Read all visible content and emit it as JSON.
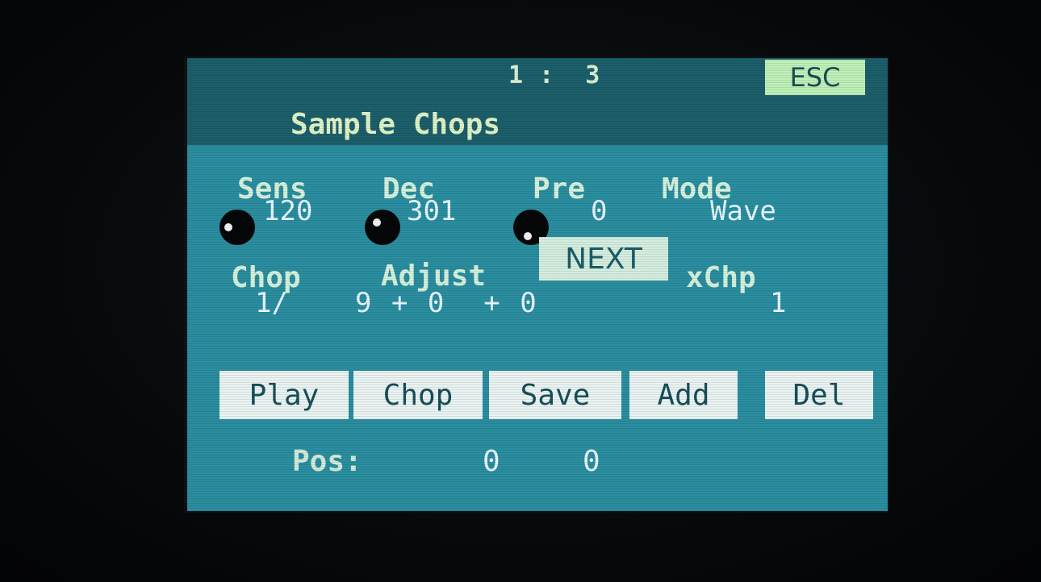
{
  "header": {
    "page_indicator": "1 :  3",
    "title": "Sample Chops",
    "esc_label": "ESC"
  },
  "params_row1": [
    {
      "label": "Sens",
      "value": "120"
    },
    {
      "label": "Dec",
      "value": "301"
    },
    {
      "label": "Pre",
      "value": "0"
    },
    {
      "label": "Mode",
      "value": "Wave"
    }
  ],
  "params_row2": {
    "chop_label": "Chop",
    "adjust_label": "Adjust",
    "xchp_label": "xChp",
    "chop_value": "1/",
    "adjust_value": "9 + 0  + 0",
    "xchp_value": "1"
  },
  "next_label": "NEXT",
  "buttons": [
    {
      "label": "Play"
    },
    {
      "label": "Chop"
    },
    {
      "label": "Save"
    },
    {
      "label": "Add"
    },
    {
      "label": "Del"
    }
  ],
  "position": {
    "label": "Pos:",
    "value1": "0",
    "value2": "0"
  },
  "colors": {
    "screen_bg": "#2a8ea0",
    "header_bg": "#1c5f6b",
    "button_bg": "#eaf4f2",
    "esc_bg": "#bff1b8",
    "text": "#d9f0d2"
  }
}
